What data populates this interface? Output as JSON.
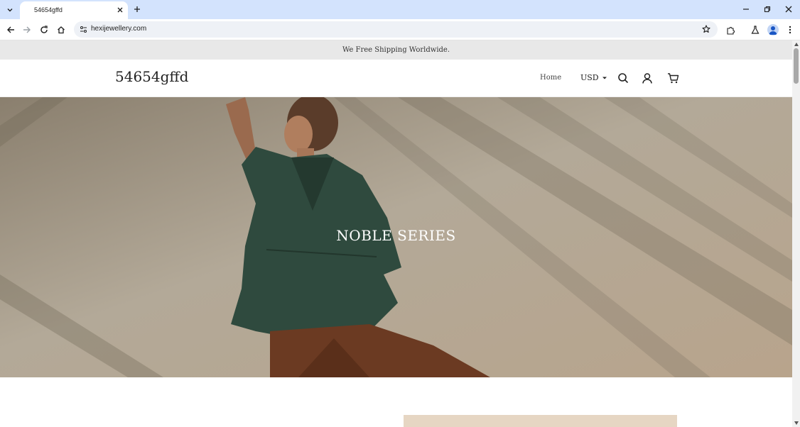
{
  "browser": {
    "tab_title": "54654gffd",
    "url": "hexijewellery.com"
  },
  "page": {
    "announcement": "We Free Shipping Worldwide.",
    "logo": "54654gffd",
    "nav": {
      "home": "Home"
    },
    "currency": "USD",
    "hero_title": "NOBLE SERIES"
  },
  "colors": {
    "tabstrip": "#d3e3fd",
    "announce_bg": "#e8e8e8",
    "hero_shirt": "#2f4a3e",
    "hero_pants": "#6b3a22"
  }
}
